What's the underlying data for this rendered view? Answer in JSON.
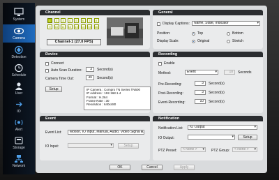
{
  "sidebar": {
    "items": [
      {
        "label": "System",
        "icon": "monitor-icon"
      },
      {
        "label": "Camera",
        "icon": "eye-icon"
      },
      {
        "label": "Detection",
        "icon": "motion-icon"
      },
      {
        "label": "Schedule",
        "icon": "clock-icon"
      },
      {
        "label": "User",
        "icon": "user-icon"
      },
      {
        "label": "IO",
        "icon": "io-icon"
      },
      {
        "label": "Alert",
        "icon": "alert-icon"
      },
      {
        "label": "Storage",
        "icon": "storage-icon"
      },
      {
        "label": "Network",
        "icon": "network-icon"
      }
    ],
    "active": "Camera"
  },
  "channel": {
    "title": "Channel",
    "channels": [
      "1",
      "2",
      "3",
      "4",
      "5",
      "6",
      "7",
      "8",
      "9",
      "10",
      "11",
      "12",
      "13",
      "14",
      "15",
      "16"
    ],
    "selected": "1",
    "label": "Channel-1 (27.0 FPS)"
  },
  "general": {
    "title": "General",
    "display_captions_label": "Display Captions:",
    "display_captions_value": "Name, State, Indicator",
    "position_label": "Position:",
    "position_top": "Top",
    "position_bottom": "Bottom",
    "display_scale_label": "Display Scale:",
    "scale_original": "Original",
    "scale_stretch": "Stretch"
  },
  "device": {
    "title": "Device",
    "connect_label": "Connect",
    "auto_scan_label": "Auto Scan Duration:",
    "auto_scan_value": "3",
    "auto_scan_unit": "Second(s)",
    "timeout_label": "Camera Time Out:",
    "timeout_value": "30",
    "timeout_unit": "Second(s)",
    "setup_label": "Setup",
    "info": [
      "IP Camera : Compro TN Series TN600",
      "IP Address : 192.168.1.4",
      "Format : H.264",
      "Frame Rate : 30",
      "Resolution : 640x480"
    ]
  },
  "recording": {
    "title": "Recording",
    "enable_label": "Enable",
    "method_label": "Method:",
    "method_value": "Event",
    "method_seconds_value": "10",
    "method_seconds_unit": "Seconds",
    "pre_label": "Pre-Recording:",
    "pre_value": "3",
    "post_label": "Post-Recording:",
    "post_value": "3",
    "event_label": "Event-Recording:",
    "event_value": "10",
    "unit": "Second(s)"
  },
  "event": {
    "title": "Event",
    "event_list_label": "Event List:",
    "event_list_value": "Motion, IO Input, Manual, Audio, Video Signal L...",
    "io_input_label": "IO Input:",
    "setup_label": "Setup"
  },
  "notification": {
    "title": "Notification",
    "list_label": "Notification List:",
    "list_value": "IO Output",
    "io_output_label": "IO Output:",
    "setup_label": "Setup",
    "ptz_preset_label": "PTZ Preset:",
    "ptz_preset_value": "< None >",
    "ptz_group_label": "PTZ Group:",
    "ptz_group_value": "< None >"
  },
  "footer": {
    "ok": "OK",
    "cancel": "Cancel",
    "apply": "Apply"
  },
  "colors": {
    "accent": "#1f6cc0",
    "channel_selected": "#b5c90a",
    "header": "#2b2d30"
  }
}
